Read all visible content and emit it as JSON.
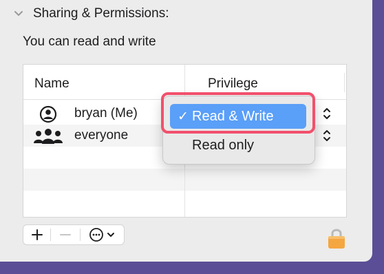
{
  "section": {
    "title": "Sharing & Permissions:",
    "collapse_icon": "chevron-down-icon"
  },
  "permission_summary": "You can read and write",
  "table": {
    "columns": [
      "Name",
      "Privilege"
    ],
    "rows": [
      {
        "icon": "person-circle-icon",
        "name": "bryan (Me)"
      },
      {
        "icon": "group-icon",
        "name": "everyone"
      }
    ]
  },
  "dropdown": {
    "options": [
      {
        "label": "Read & Write",
        "selected": true,
        "check": "✓"
      },
      {
        "label": "Read only",
        "selected": false
      }
    ]
  },
  "toolbar": {
    "add_icon": "plus-icon",
    "remove_icon": "minus-icon",
    "more_icon": "ellipsis-circle-icon",
    "more_menu_icon": "chevron-down-icon"
  },
  "lock_icon": "lock-icon",
  "colors": {
    "background": "#5b4e96",
    "panel": "#ececec",
    "selection": "#5a9ff8",
    "highlight": "#f2506c",
    "lock": "#f4a640"
  }
}
